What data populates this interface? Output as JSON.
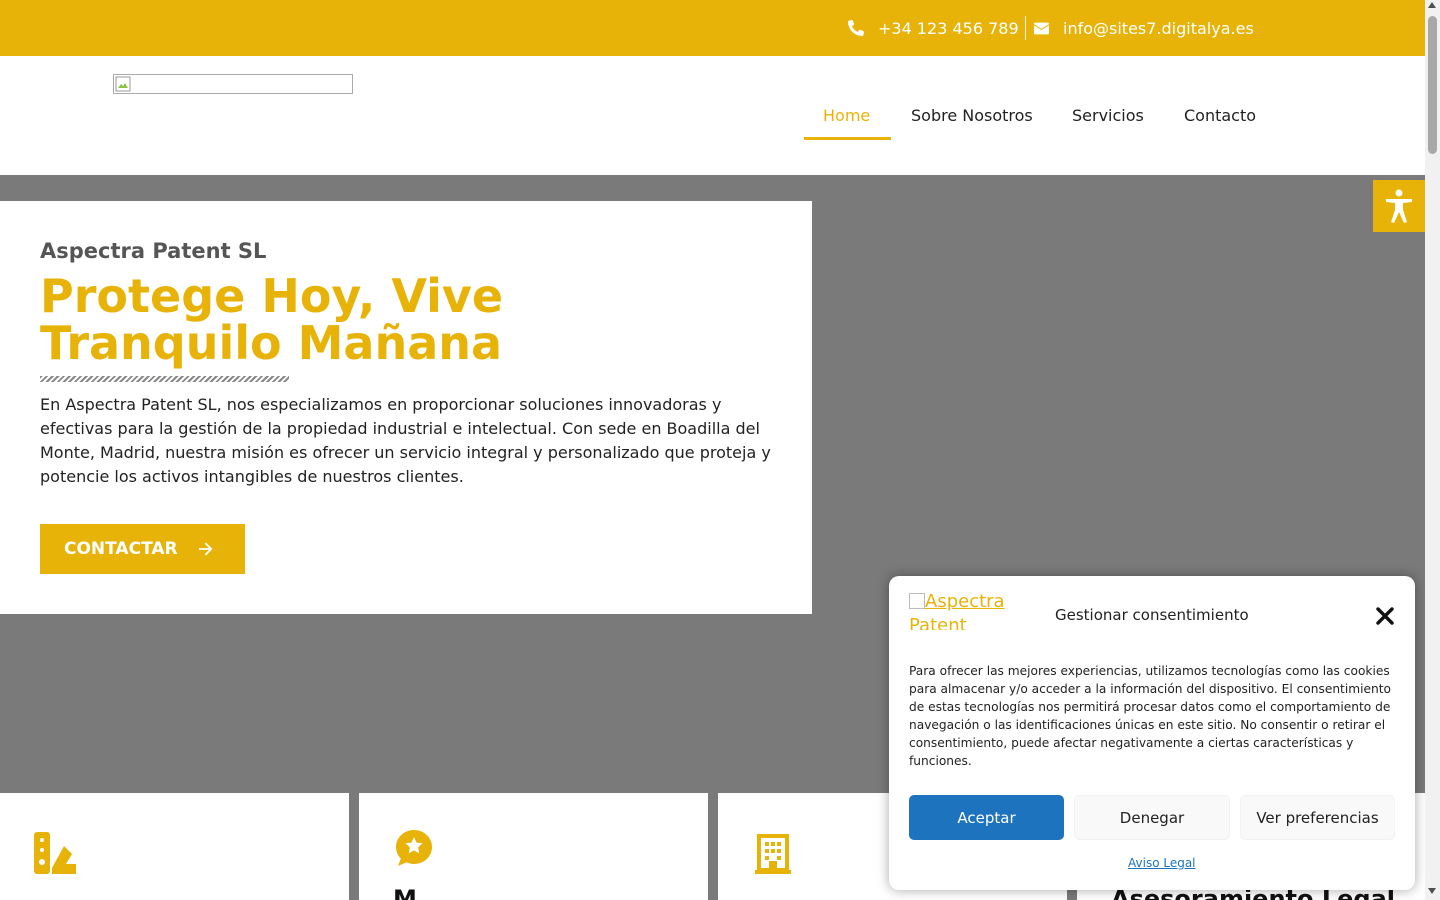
{
  "topbar": {
    "phone": "+34 123 456 789",
    "email": "info@sites7.digitalya.es"
  },
  "nav": {
    "items": [
      "Home",
      "Sobre Nosotros",
      "Servicios",
      "Contacto"
    ],
    "active": "Home"
  },
  "hero": {
    "company": "Aspectra Patent SL",
    "headline": "Protege Hoy, Vive Tranquilo Mañana",
    "description": "En Aspectra Patent SL, nos especializamos en proporcionar soluciones innovadoras y efectivas para la gestión de la propiedad industrial e intelectual. Con sede en Boadilla del Monte, Madrid, nuestra misión es ofrecer un servicio integral y personalizado que proteja y potencie los activos intangibles de nuestros clientes.",
    "cta_label": "CONTACTAR"
  },
  "cards": [
    {
      "icon": "swatchbook-icon",
      "title": ""
    },
    {
      "icon": "star-comment-icon",
      "title": "M"
    },
    {
      "icon": "building-icon",
      "title": ""
    },
    {
      "icon": "document-icon",
      "title": "Asesoramiento Legal"
    }
  ],
  "consent": {
    "logo_alt": "Aspectra Patent",
    "title": "Gestionar consentimiento",
    "text": "Para ofrecer las mejores experiencias, utilizamos tecnologías como las cookies para almacenar y/o acceder a la información del dispositivo. El consentimiento de estas tecnologías nos permitirá procesar datos como el comportamiento de navegación o las identificaciones únicas en este sitio. No consentir o retirar el consentimiento, puede afectar negativamente a ciertas características y funciones.",
    "accept_label": "Aceptar",
    "deny_label": "Denegar",
    "prefs_label": "Ver preferencias",
    "legal_label": "Aviso Legal"
  },
  "colors": {
    "accent": "#e8b308",
    "hero_bg": "#7a7a7a",
    "accept_button": "#1e73be"
  }
}
